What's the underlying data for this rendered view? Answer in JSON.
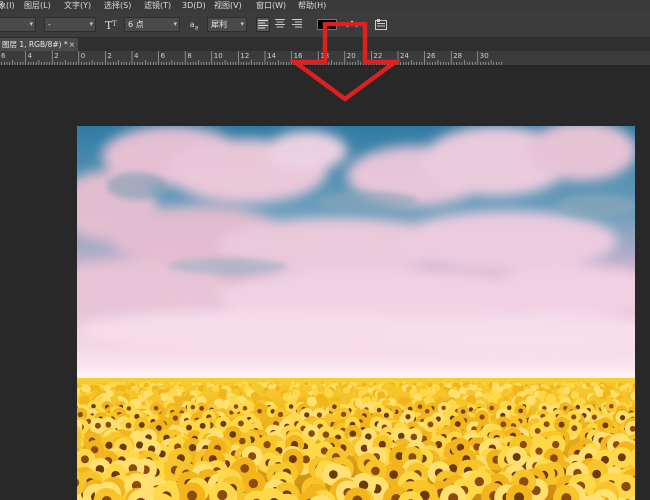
{
  "menu": {
    "items": [
      "象(I)",
      "图层(L)",
      "文字(Y)",
      "选择(S)",
      "滤镜(T)",
      "3D(D)",
      "视图(V)",
      "窗口(W)",
      "帮助(H)"
    ]
  },
  "options": {
    "font_style_value": "-",
    "size_icon": "font-size-icon",
    "font_size_value": "6 点",
    "aa_label": "a",
    "antialias_value": "犀利",
    "align_icons": [
      "align-left-icon",
      "align-center-icon",
      "align-right-icon"
    ],
    "warp_icon": "warp-text-icon",
    "panel_icon": "character-panel-icon",
    "color_swatch": "#000000"
  },
  "document": {
    "tab_label": "图层 1, RGB/8#) *",
    "close_glyph": "×"
  },
  "ruler": {
    "labels": [
      "6",
      "4",
      "2",
      "0",
      "2",
      "4",
      "6",
      "8",
      "10",
      "12",
      "14",
      "16",
      "18",
      "20",
      "22",
      "24",
      "26",
      "28",
      "30"
    ]
  },
  "annotation": {
    "arrow_color": "#e02020"
  }
}
